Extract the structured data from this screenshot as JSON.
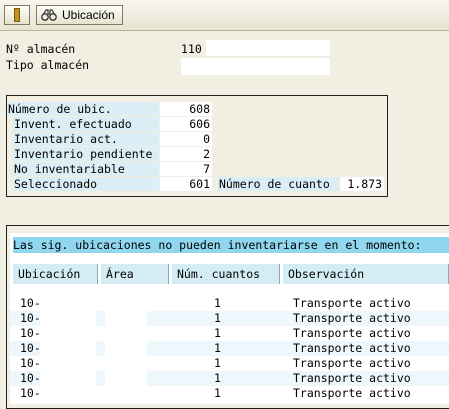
{
  "toolbar": {
    "highlight_icon": "highlighter-icon",
    "location_icon": "binoculars-icon",
    "location_label": "Ubicación"
  },
  "header": {
    "warehouse_label": "Nº almacén",
    "warehouse_value": "110",
    "storage_type_label": "Tipo almacén"
  },
  "summary": {
    "num_bins_label": "Número de ubic.",
    "num_bins_value": "608",
    "inventoried_label": "Invent. efectuado",
    "inventoried_value": "606",
    "active_label": "Inventario act.",
    "active_value": "0",
    "pending_label": "Inventario pendiente",
    "pending_value": "2",
    "not_inventoriable_label": "No inventariable",
    "not_inventoriable_value": "7",
    "selected_label": "Seleccionado",
    "selected_value": "601",
    "count_label": "Número de cuanto",
    "count_value": "1.873"
  },
  "table": {
    "message": "Las sig. ubicaciones no pueden inventariarse en el momento:",
    "columns": [
      "Ubicación",
      "Área",
      "Núm. cuantos",
      "Observación"
    ],
    "rows": [
      {
        "bin": "10-",
        "count": "1",
        "note": "Transporte activo"
      },
      {
        "bin": "10-",
        "count": "1",
        "note": "Transporte activo"
      },
      {
        "bin": "10-",
        "count": "1",
        "note": "Transporte activo"
      },
      {
        "bin": "10-",
        "count": "1",
        "note": "Transporte activo"
      },
      {
        "bin": "10-",
        "count": "1",
        "note": "Transporte activo"
      },
      {
        "bin": "10-",
        "count": "1",
        "note": "Transporte activo"
      },
      {
        "bin": "10-",
        "count": "1",
        "note": "Transporte activo"
      }
    ]
  }
}
